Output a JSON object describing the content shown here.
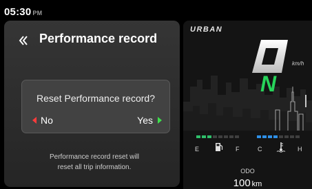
{
  "status": {
    "time": "05:30",
    "ampm": "PM"
  },
  "screen": {
    "title": "Performance record",
    "back_icon": "chevron-left-icon",
    "dialog": {
      "question": "Reset Performance record?",
      "no_label": "No",
      "yes_label": "Yes"
    },
    "info_line1": "Performance record reset will",
    "info_line2": "reset all trip information."
  },
  "cluster": {
    "brand": "URBAN",
    "speed_unit": "km/h",
    "gear": "N",
    "fuel": {
      "empty_label": "E",
      "full_label": "F",
      "icon": "fuel-pump-icon",
      "level_segments": 3,
      "total_segments": 8
    },
    "temp": {
      "cold_label": "C",
      "hot_label": "H",
      "icon": "coolant-temp-icon",
      "level_segments": 4,
      "total_segments": 8
    },
    "odo_label": "ODO",
    "odo_value": "100",
    "odo_unit": "km"
  },
  "colors": {
    "accent_no": "#ff3b3b",
    "accent_yes": "#3ddf4c",
    "gear": "#27d35a",
    "fuel_bar": "#2fbf6a",
    "temp_bar": "#2e8fe6"
  }
}
